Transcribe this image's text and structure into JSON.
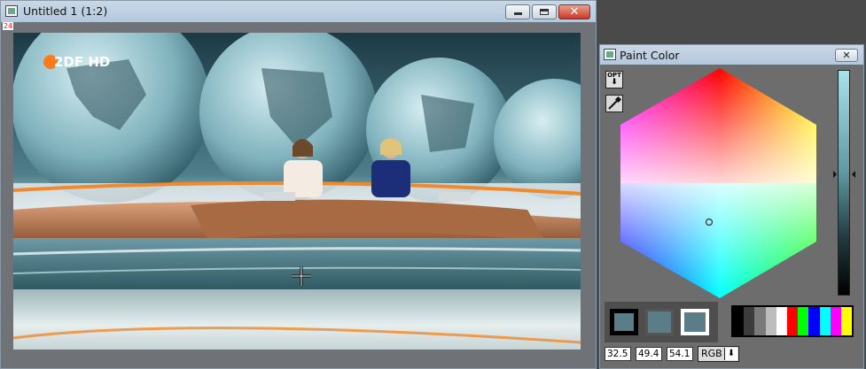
{
  "viewer": {
    "title": "Untitled 1 (1:2)",
    "zoom_badge": "24",
    "logo_text": "2DF HD",
    "controls": {
      "minimize": "minimize",
      "maximize": "maximize",
      "close": "✕"
    }
  },
  "paint_color": {
    "title": "Paint Color",
    "close_label": "✕",
    "opt_button": "OPT",
    "values": [
      "32.5",
      "49.4",
      "54.1"
    ],
    "mode": "RGB",
    "mode_arrow": "⬇",
    "current_color": "#5a7d87",
    "palette": [
      "#000000",
      "#3c3c3c",
      "#7a7a7a",
      "#bdbdbd",
      "#ffffff",
      "#ff0000",
      "#00ff00",
      "#0000ff",
      "#00ffff",
      "#ff00ff",
      "#ffff00"
    ]
  },
  "colors": {
    "accent_orange": "#ff7a18",
    "title_bg": "#c4d5e6",
    "panel_bg": "#6d6d6d"
  }
}
